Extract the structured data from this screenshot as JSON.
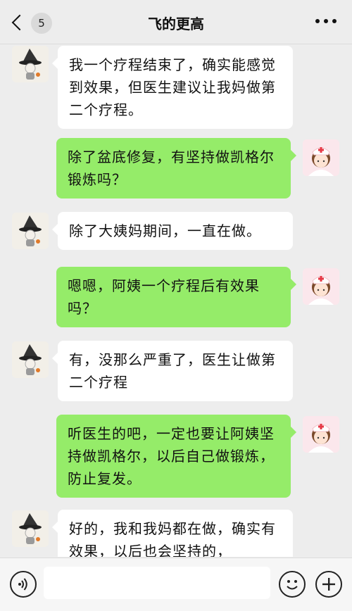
{
  "header": {
    "title": "飞的更高",
    "unread_count": "5",
    "back_icon": "chevron-left-icon",
    "more_icon": "more-dots-icon"
  },
  "messages": [
    {
      "side": "left",
      "text": "我一个疗程结束了，确实能感觉到效果，但医生建议让我妈做第二个疗程。"
    },
    {
      "side": "right",
      "text": "除了盆底修复，有坚持做凯格尔锻炼吗？"
    },
    {
      "side": "left",
      "text": "除了大姨妈期间，一直在做。"
    },
    {
      "side": "right",
      "text": "嗯嗯，阿姨一个疗程后有效果吗？"
    },
    {
      "side": "left",
      "text": "有，没那么严重了，医生让做第二个疗程"
    },
    {
      "side": "right",
      "text": "听医生的吧，一定也要让阿姨坚持做凯格尔，以后自己做锻炼，防止复发。"
    },
    {
      "side": "left",
      "text": "好的，我和我妈都在做，确实有效果，以后也会坚持的，"
    }
  ],
  "input": {
    "value": "",
    "voice_icon": "voice-icon",
    "emoji_icon": "emoji-icon",
    "plus_icon": "plus-icon"
  },
  "colors": {
    "background": "#ededed",
    "outgoing_bubble": "#95ec69",
    "incoming_bubble": "#ffffff"
  },
  "avatars": {
    "left": "witch-hat-avatar",
    "right": "nurse-avatar"
  }
}
